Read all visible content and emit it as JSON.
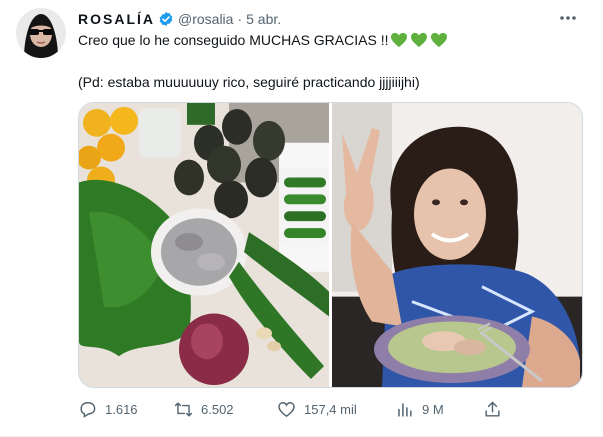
{
  "author": {
    "display_name": "ROSALÍA",
    "handle": "@rosalia",
    "separator": "·",
    "date": "5 abr."
  },
  "tweet": {
    "line1": "Creo que lo he conseguido MUCHAS GRACIAS !!",
    "line1_emoji": "green-heart-icon x3",
    "line2": "(Pd: estaba muuuuuuy rico, seguiré practicando jjjjiiijhi)"
  },
  "actions": {
    "replies": "1.616",
    "retweets": "6.502",
    "likes": "157,4 mil",
    "views": "9 M"
  },
  "icons": [
    "more-icon",
    "verified-icon",
    "green-heart-icon",
    "reply-icon",
    "retweet-icon",
    "like-icon",
    "views-icon",
    "share-icon"
  ],
  "colors": {
    "text": "#0f1419",
    "muted": "#536471",
    "verified": "#1d9bf0",
    "heart": "#5fb13d"
  }
}
